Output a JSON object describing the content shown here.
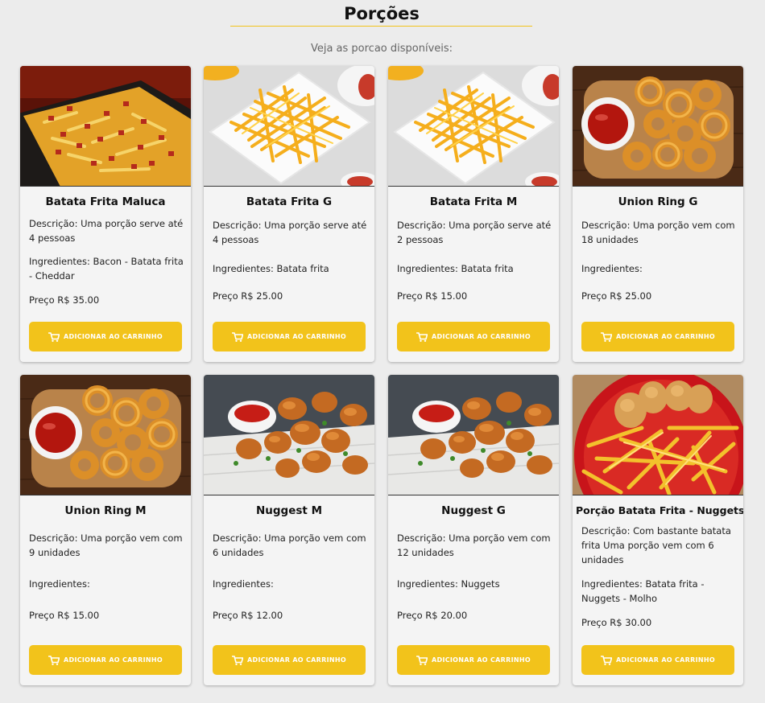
{
  "header": {
    "title": "Porções",
    "subtitle": "Veja as porcao disponíveis:"
  },
  "products": [
    {
      "name": "Batata Frita Maluca",
      "description": "Descrição: Uma porção serve até 4 pessoas",
      "ingredients": "Ingredientes: Bacon - Batata frita - Cheddar",
      "price": "Preço R$ 35.00",
      "button": "Adicionar ao carrinho",
      "image_icon": "loaded-fries-photo"
    },
    {
      "name": "Batata Frita G",
      "description": "Descrição: Uma porção serve até 4 pessoas",
      "ingredients": "Ingredientes: Batata frita",
      "price": "Preço R$ 25.00",
      "button": "Adicionar ao carrinho",
      "image_icon": "fries-plate-photo"
    },
    {
      "name": "Batata Frita M",
      "description": "Descrição: Uma porção serve até 2 pessoas",
      "ingredients": "Ingredientes: Batata frita",
      "price": "Preço R$ 15.00",
      "button": "Adicionar ao carrinho",
      "image_icon": "fries-plate-photo"
    },
    {
      "name": "Union Ring G",
      "description": "Descrição: Uma porção vem com 18 unidades",
      "ingredients": "Ingredientes:",
      "price": "Preço R$ 25.00",
      "button": "Adicionar ao carrinho",
      "image_icon": "onion-rings-photo"
    },
    {
      "name": "Union Ring M",
      "description": "Descrição: Uma porção vem com 9 unidades",
      "ingredients": "Ingredientes:",
      "price": "Preço R$ 15.00",
      "button": "Adicionar ao carrinho",
      "image_icon": "onion-rings-photo"
    },
    {
      "name": "Nuggest M",
      "description": "Descrição: Uma porção vem com 6 unidades",
      "ingredients": "Ingredientes:",
      "price": "Preço R$ 12.00",
      "button": "Adicionar ao carrinho",
      "image_icon": "nuggets-photo"
    },
    {
      "name": "Nuggest G",
      "description": "Descrição: Uma porção vem com 12 unidades",
      "ingredients": "Ingredientes: Nuggets",
      "price": "Preço R$ 20.00",
      "button": "Adicionar ao carrinho",
      "image_icon": "nuggets-photo"
    },
    {
      "name": "Porção Batata Frita - Nuggets",
      "description": "Descrição: Com bastante batata frita Uma porção vem com 6 unidades",
      "ingredients": "Ingredientes: Batata frita - Nuggets - Molho",
      "price": "Preço R$ 30.00",
      "button": "Adicionar ao carrinho",
      "image_icon": "fries-nuggets-bowl-photo"
    }
  ],
  "colors": {
    "accent": "#f2c31b",
    "card": "#f4f4f4",
    "background": "#ececec"
  }
}
